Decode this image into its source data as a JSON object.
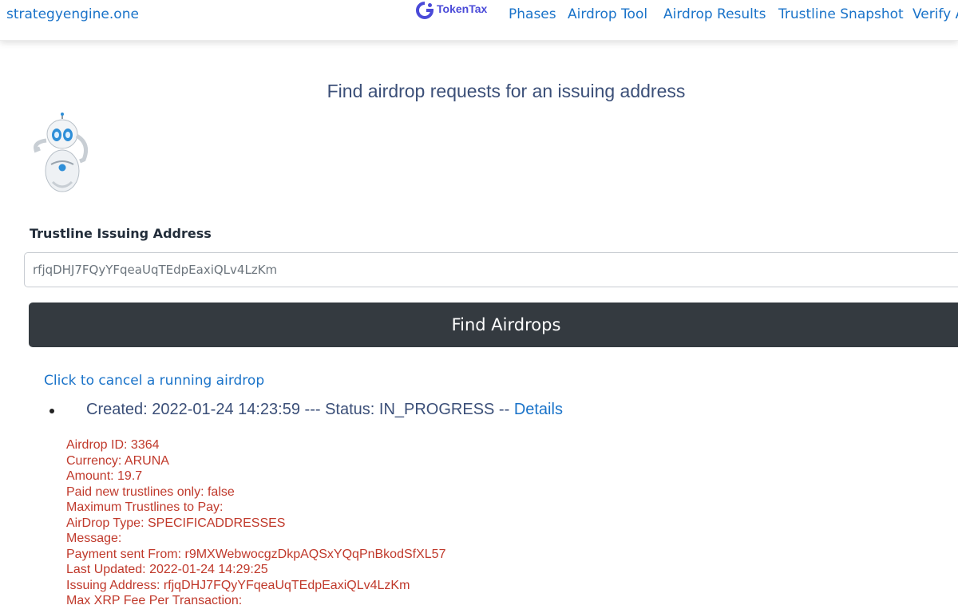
{
  "navbar": {
    "brand": "strategyengine.one",
    "logo_text": "TokenTax",
    "links": [
      "Phases",
      "Airdrop Tool",
      "Airdrop Results",
      "Trustline Snapshot",
      "Verify A"
    ]
  },
  "page": {
    "title": "Find airdrop requests for an issuing address"
  },
  "form": {
    "label": "Trustline Issuing Address",
    "address_value": "rfjqDHJ7FQyYFqeaUqTEdpEaxiQLv4LzKm",
    "button_label": "Find Airdrops"
  },
  "results": {
    "cancel_link": "Click to cancel a running airdrop",
    "airdrop": {
      "summary": "Created: 2022-01-24 14:23:59 --- Status: IN_PROGRESS --",
      "details_link": "Details",
      "fields": [
        "Airdrop ID: 3364",
        "Currency: ARUNA",
        "Amount: 19.7",
        "Paid new trustlines only: false",
        "Maximum Trustlines to Pay:",
        "AirDrop Type: SPECIFICADDRESSES",
        "Message:",
        "Payment sent From: r9MXWebwocgzDkpAQSxYQqPnBkodSfXL57",
        "Last Updated: 2022-01-24 14:29:25",
        "Issuing Address: rfjqDHJ7FQyYFqeaUqTEdpEaxiQLv4LzKm",
        "Max XRP Fee Per Transaction:"
      ]
    }
  },
  "colors": {
    "link": "#1a73c9",
    "title": "#3b4f78",
    "button_bg": "#343a40",
    "detail_text": "#c0392b",
    "logo": "#4a4ad8"
  },
  "icons": {
    "logo": "tokentax-logo-icon",
    "mascot": "robot-mascot-icon"
  }
}
